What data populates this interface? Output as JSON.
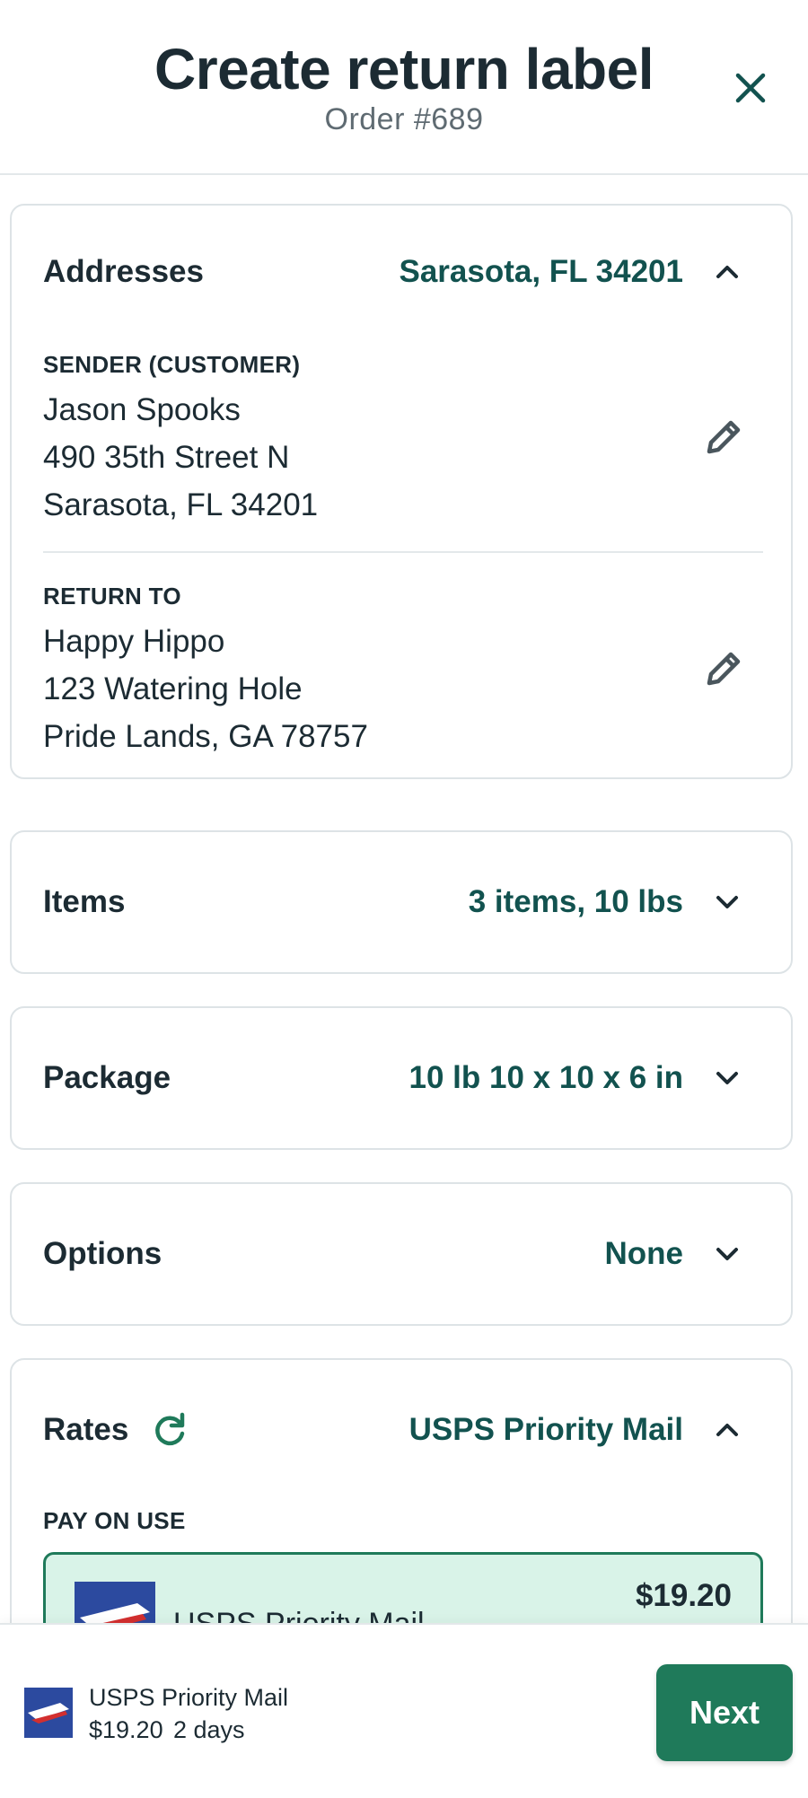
{
  "header": {
    "title": "Create return label",
    "subtitle": "Order #689",
    "close_icon": "close-icon"
  },
  "addresses": {
    "label": "Addresses",
    "summary": "Sarasota, FL 34201",
    "expanded": true,
    "sender": {
      "label": "SENDER (CUSTOMER)",
      "name": "Jason Spooks",
      "street": "490 35th Street N",
      "city": "Sarasota, FL 34201"
    },
    "return_to": {
      "label": "RETURN TO",
      "name": "Happy Hippo",
      "street": "123 Watering Hole",
      "city": "Pride Lands, GA 78757"
    }
  },
  "items": {
    "label": "Items",
    "summary": "3 items, 10 lbs",
    "expanded": false
  },
  "package": {
    "label": "Package",
    "summary": "10 lb 10 x 10 x 6 in",
    "expanded": false
  },
  "options": {
    "label": "Options",
    "summary": "None",
    "expanded": false
  },
  "rates": {
    "label": "Rates",
    "summary": "USPS Priority Mail",
    "expanded": true,
    "section_label": "PAY ON USE",
    "selected_option": {
      "carrier": "USPS Priority Mail",
      "price": "$19.20"
    }
  },
  "footer": {
    "carrier": "USPS Priority Mail",
    "price": "$19.20",
    "days": "2 days",
    "next_label": "Next"
  },
  "colors": {
    "accent": "#1f7a5a",
    "value_text": "#12524f",
    "selected_bg": "#d9f3e8",
    "usps_blue": "#2c4a9f"
  }
}
